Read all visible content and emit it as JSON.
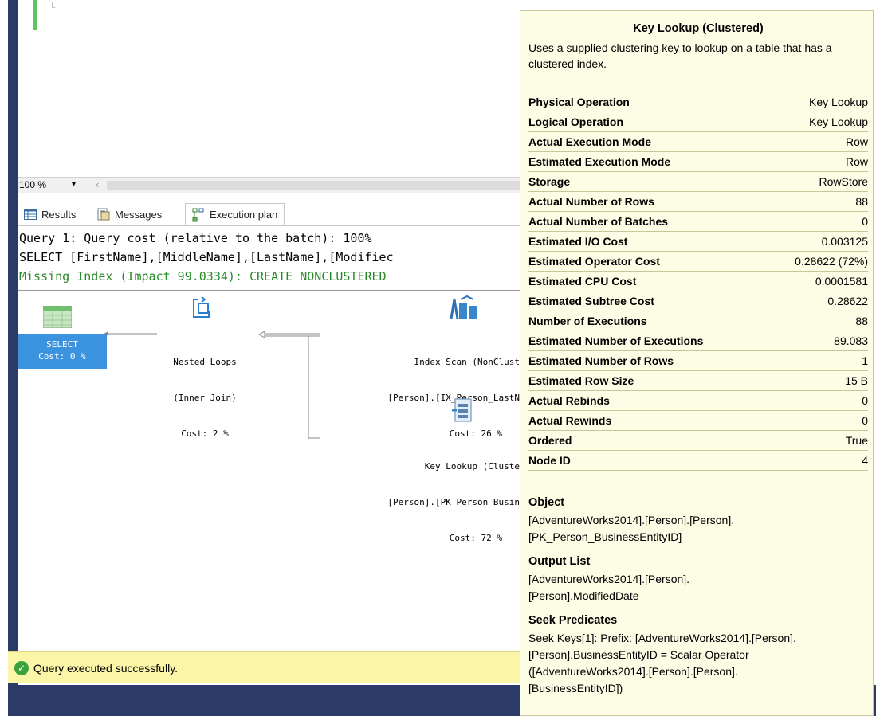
{
  "editor": {
    "line_marker": "L"
  },
  "zoom": {
    "level": "100 %",
    "dropdown_glyph": "▾",
    "scroll_glyph": "‹"
  },
  "tabs": [
    {
      "label": "Results"
    },
    {
      "label": "Messages"
    },
    {
      "label": "Execution plan"
    }
  ],
  "plan": {
    "line1": "Query 1: Query cost (relative to the batch): 100%",
    "line2": "SELECT [FirstName],[MiddleName],[LastName],[Modifiec",
    "line3": "Missing Index (Impact 99.0334): CREATE NONCLUSTERED",
    "nodes": {
      "select": {
        "name": "SELECT",
        "cost": "Cost: 0 %"
      },
      "nested_loops": {
        "name": "Nested Loops",
        "sub": "(Inner Join)",
        "cost": "Cost: 2 %"
      },
      "index_scan": {
        "name": "Index Scan (NonClust",
        "sub": "[Person].[IX_Person_LastN",
        "cost": "Cost: 26 %"
      },
      "key_lookup": {
        "name": "Key Lookup (Cluste",
        "sub": "[Person].[PK_Person_Busin",
        "cost": "Cost: 72 %"
      }
    }
  },
  "status": {
    "message": "Query executed successfully."
  },
  "tooltip": {
    "title": "Key Lookup (Clustered)",
    "description": "Uses a supplied clustering key to lookup on a table that has a clustered index.",
    "properties": [
      {
        "key": "Physical Operation",
        "value": "Key Lookup"
      },
      {
        "key": "Logical Operation",
        "value": "Key Lookup"
      },
      {
        "key": "Actual Execution Mode",
        "value": "Row"
      },
      {
        "key": "Estimated Execution Mode",
        "value": "Row"
      },
      {
        "key": "Storage",
        "value": "RowStore"
      },
      {
        "key": "Actual Number of Rows",
        "value": "88"
      },
      {
        "key": "Actual Number of Batches",
        "value": "0"
      },
      {
        "key": "Estimated I/O Cost",
        "value": "0.003125"
      },
      {
        "key": "Estimated Operator Cost",
        "value": "0.28622 (72%)"
      },
      {
        "key": "Estimated CPU Cost",
        "value": "0.0001581"
      },
      {
        "key": "Estimated Subtree Cost",
        "value": "0.28622"
      },
      {
        "key": "Number of Executions",
        "value": "88"
      },
      {
        "key": "Estimated Number of Executions",
        "value": "89.083"
      },
      {
        "key": "Estimated Number of Rows",
        "value": "1"
      },
      {
        "key": "Estimated Row Size",
        "value": "15 B"
      },
      {
        "key": "Actual Rebinds",
        "value": "0"
      },
      {
        "key": "Actual Rewinds",
        "value": "0"
      },
      {
        "key": "Ordered",
        "value": "True"
      },
      {
        "key": "Node ID",
        "value": "4"
      }
    ],
    "object_heading": "Object",
    "object_value": "[AdventureWorks2014].[Person].[Person].\n[PK_Person_BusinessEntityID]",
    "output_heading": "Output List",
    "output_value": "[AdventureWorks2014].[Person].\n[Person].ModifiedDate",
    "seek_heading": "Seek Predicates",
    "seek_value": "Seek Keys[1]: Prefix: [AdventureWorks2014].[Person].\n[Person].BusinessEntityID = Scalar Operator\n([AdventureWorks2014].[Person].[Person].\n[BusinessEntityID])"
  }
}
